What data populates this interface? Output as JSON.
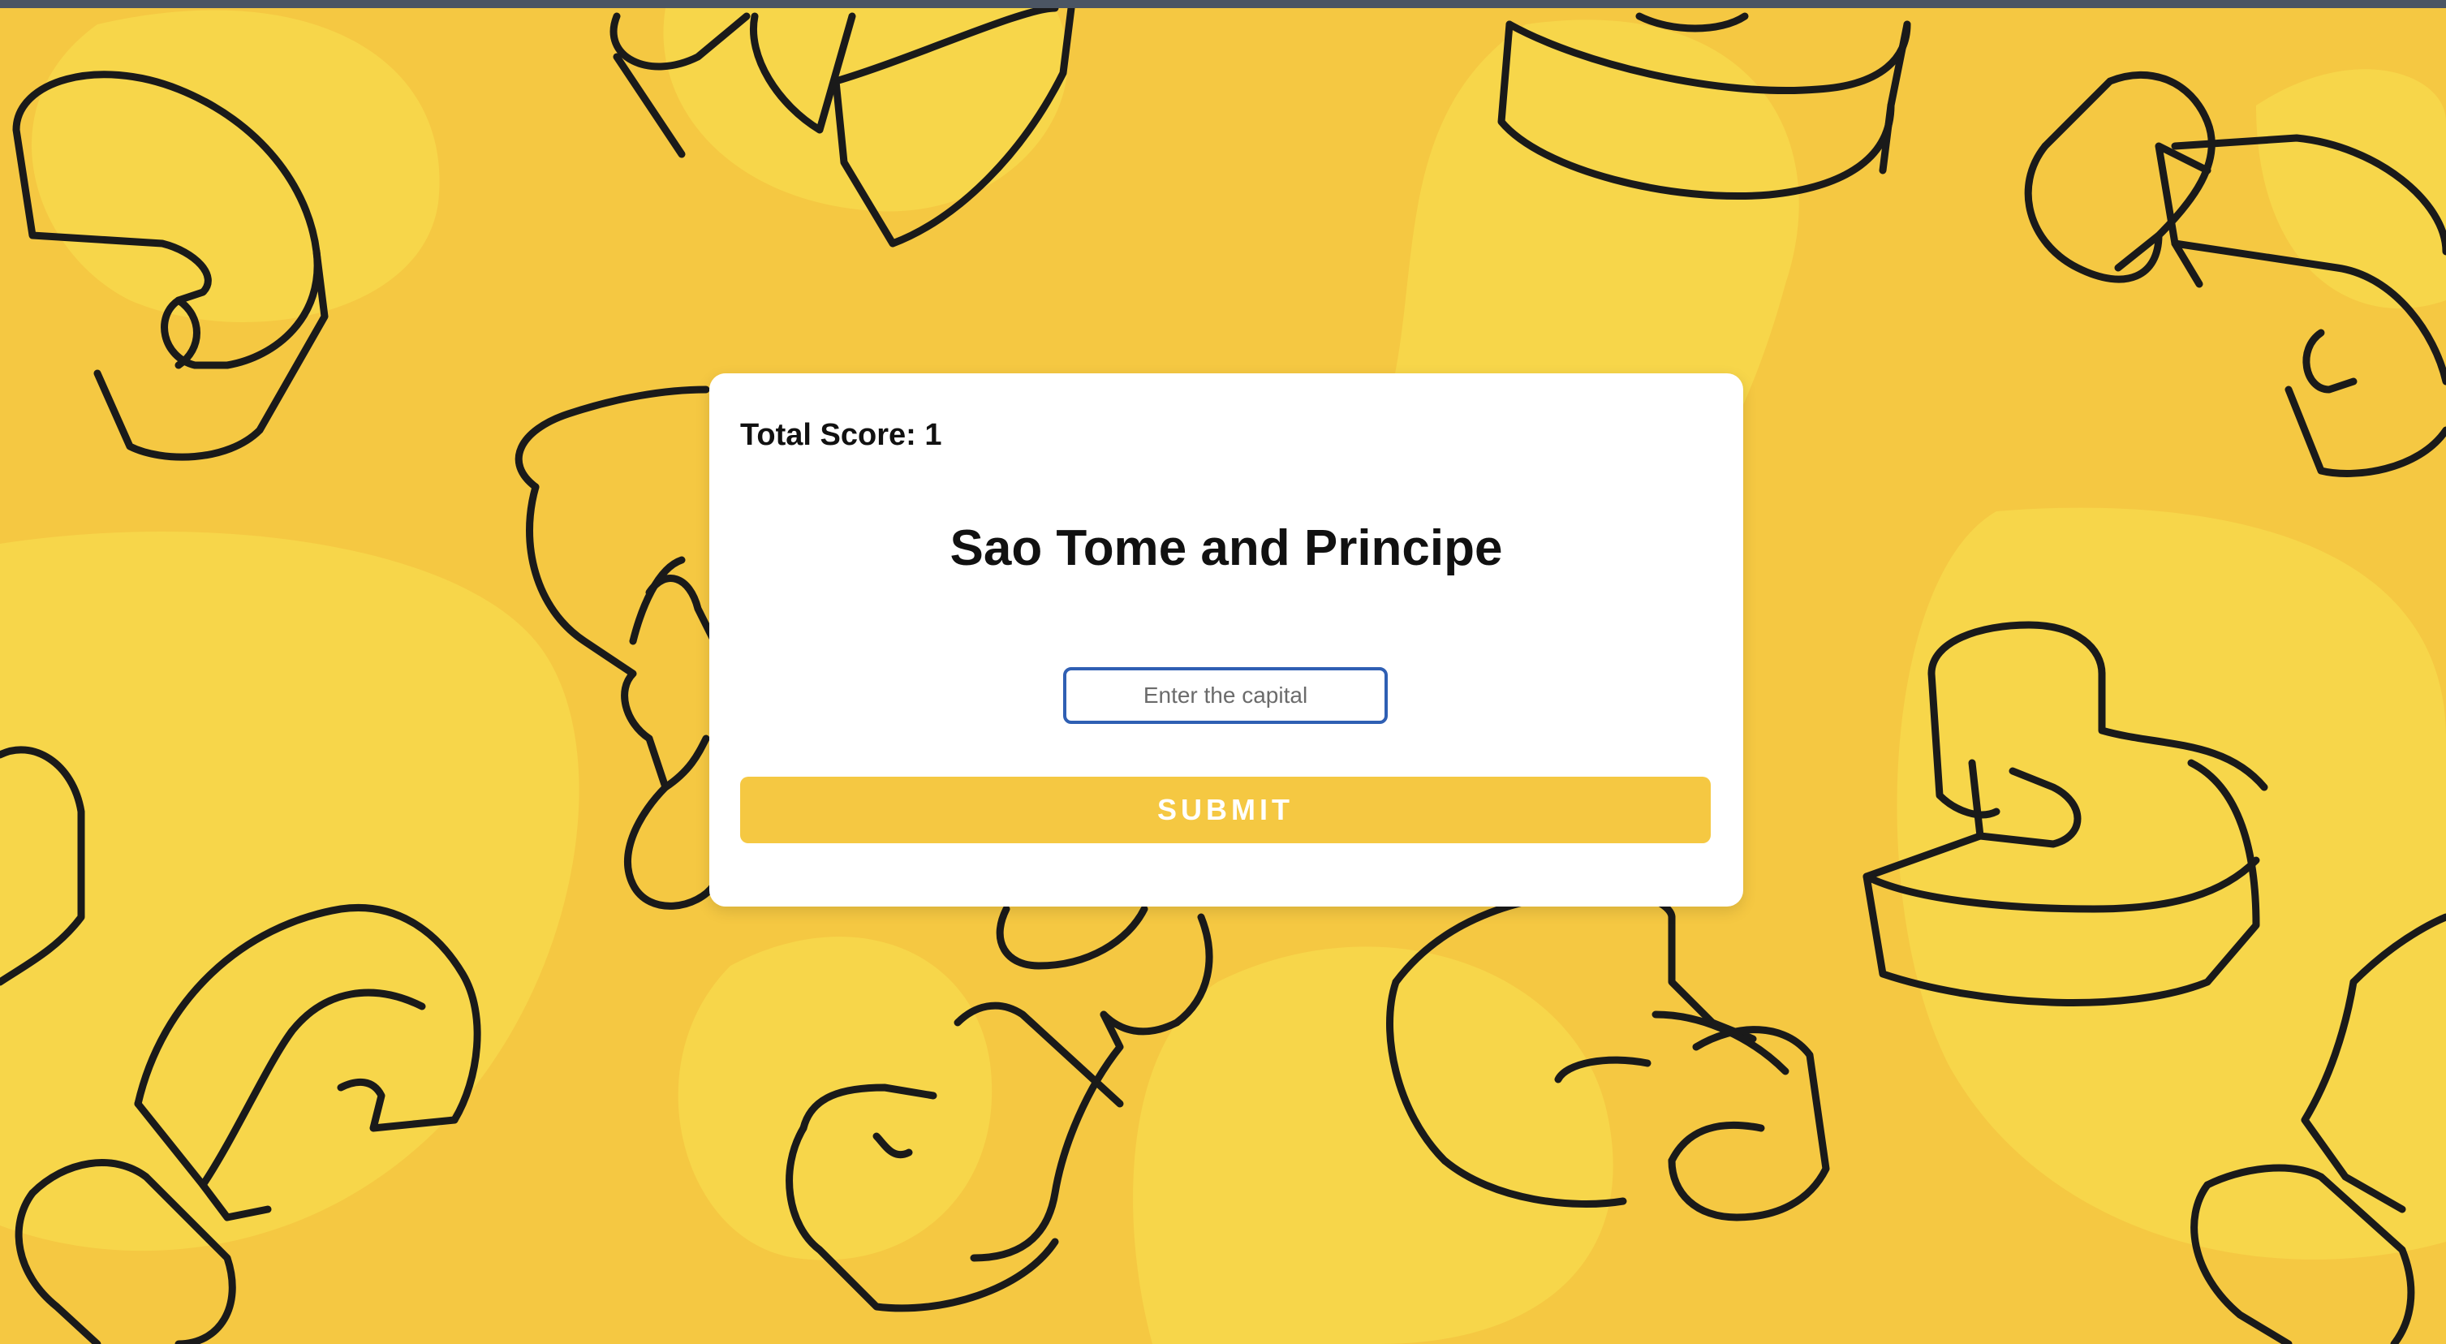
{
  "page": {
    "background_color": "#f5c842",
    "accent_color": "#f5c842",
    "input_border_color": "#2f5fb3"
  },
  "quiz": {
    "score_text": "Total Score: 1",
    "country": "Sao Tome and Principe",
    "capital_input": {
      "placeholder": "Enter the capital",
      "value": ""
    },
    "submit_label": "SUBMIT"
  },
  "background": {
    "decoration": "question-mark-pattern"
  }
}
